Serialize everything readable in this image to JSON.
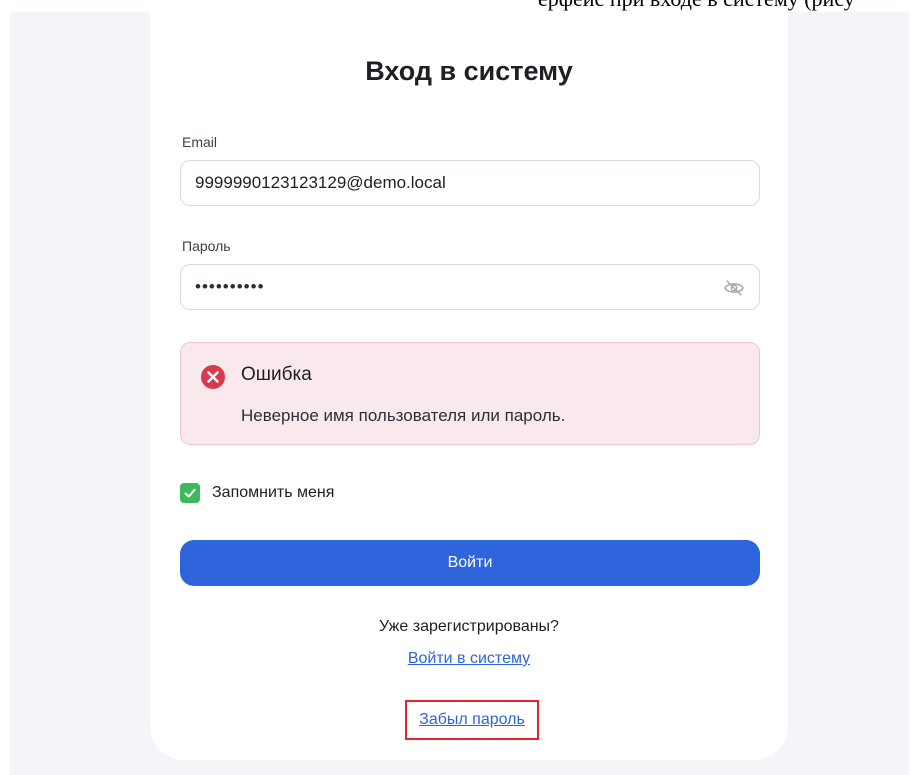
{
  "page": {
    "top_text": "ерфейс при входе в систему (рису",
    "title": "Вход в систему"
  },
  "form": {
    "email_label": "Email",
    "email_value": "9999990123123129@demo.local",
    "password_label": "Пароль",
    "password_masked": "••••••••••",
    "password_visibility_icon": "eye-off-icon"
  },
  "alert": {
    "icon": "error-x-icon",
    "title": "Ошибка",
    "message": "Неверное имя пользователя или пароль."
  },
  "remember": {
    "label": "Запомнить меня",
    "checked": true
  },
  "actions": {
    "login_label": "Войти",
    "registered_text": "Уже зарегистрированы?",
    "signin_link": "Войти в систему",
    "forgot_link": "Забыл пароль"
  },
  "colors": {
    "primary": "#2e64dc",
    "error": "#d63b4f",
    "success": "#3fb85c",
    "highlight_border": "#e3262e"
  }
}
